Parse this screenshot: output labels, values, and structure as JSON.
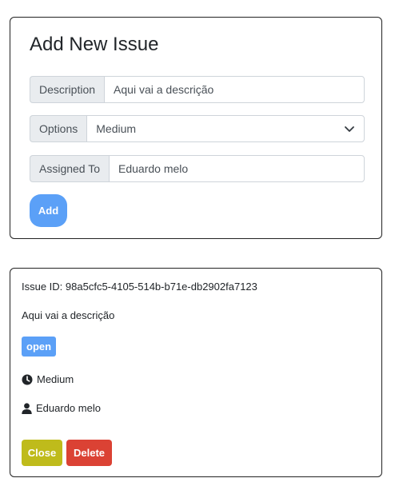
{
  "form": {
    "title": "Add New Issue",
    "description": {
      "label": "Description",
      "value": "Aqui vai a descrição"
    },
    "options": {
      "label": "Options",
      "selected": "Medium"
    },
    "assigned": {
      "label": "Assigned To",
      "value": "Eduardo melo"
    },
    "add_label": "Add"
  },
  "issue": {
    "id_text": "Issue ID: 98a5cfc5-4105-514b-b71e-db2902fa7123",
    "description": "Aqui vai a descrição",
    "status": "open",
    "severity": "Medium",
    "assignee": "Eduardo melo",
    "close_label": "Close",
    "delete_label": "Delete"
  },
  "colors": {
    "primary": "#5ba0f7",
    "warning": "#bfbb1b",
    "danger": "#db4234"
  },
  "icons": {
    "options_caret": "chevron-down-icon",
    "severity": "clock-icon",
    "assignee": "user-icon"
  }
}
